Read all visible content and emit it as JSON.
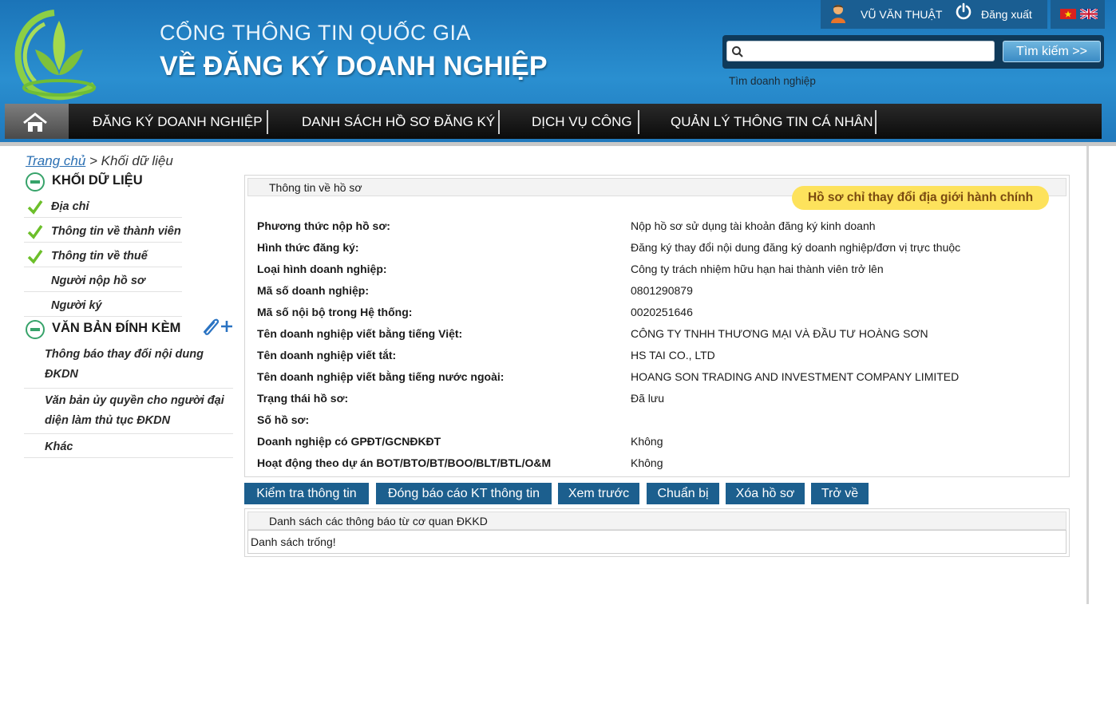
{
  "header": {
    "title_line1": "CỔNG THÔNG TIN QUỐC GIA",
    "title_line2": "VỀ ĐĂNG KÝ DOANH NGHIỆP",
    "user_name": "VŨ VĂN THUẬT",
    "logout": "Đăng xuất",
    "search_placeholder": "",
    "search_button": "Tìm kiếm >>",
    "search_link": "Tìm doanh nghiệp"
  },
  "nav": {
    "items": [
      {
        "label": "ĐĂNG KÝ DOANH NGHIỆP"
      },
      {
        "label": "DANH SÁCH HỒ SƠ ĐĂNG KÝ"
      },
      {
        "label": "DỊCH VỤ CÔNG"
      },
      {
        "label": "QUẢN LÝ THÔNG TIN CÁ NHÂN"
      }
    ]
  },
  "breadcrumb": {
    "home": "Trang chủ",
    "separator": " > ",
    "current": "Khối dữ liệu"
  },
  "sidebar": {
    "section1_title": "KHỐI DỮ LIỆU",
    "section1_items": [
      {
        "label": "Địa chỉ",
        "checked": true
      },
      {
        "label": "Thông tin về thành viên",
        "checked": true
      },
      {
        "label": "Thông tin về thuế",
        "checked": true
      },
      {
        "label": "Người nộp hồ sơ",
        "checked": false
      },
      {
        "label": "Người ký",
        "checked": false
      }
    ],
    "section2_title": "VĂN BẢN ĐÍNH KÈM",
    "section2_items": [
      {
        "line1": "Thông báo thay đổi nội dung",
        "line2": "ĐKDN"
      },
      {
        "line1": "Văn bản ủy quyền cho người đại",
        "line2": "diện làm thủ tục ĐKDN"
      },
      {
        "line1": "Khác",
        "line2": ""
      }
    ]
  },
  "record": {
    "panel_title": "Thông tin về hồ sơ",
    "badge": "Hồ sơ chỉ thay đổi địa giới hành chính",
    "rows": [
      {
        "label": "Phương thức nộp hồ sơ:",
        "value": "Nộp hồ sơ sử dụng tài khoản đăng ký kinh doanh"
      },
      {
        "label": "Hình thức đăng ký:",
        "value": "Đăng ký thay đổi nội dung đăng ký doanh nghiệp/đơn vị trực thuộc"
      },
      {
        "label": "Loại hình doanh nghiệp:",
        "value": "Công ty trách nhiệm hữu hạn hai thành viên trở lên"
      },
      {
        "label": "Mã số doanh nghiệp:",
        "value": "0801290879"
      },
      {
        "label": "Mã số nội bộ trong Hệ thống:",
        "value": "0020251646"
      },
      {
        "label": "Tên doanh nghiệp viết bằng tiếng Việt:",
        "value": "CÔNG TY TNHH THƯƠNG MẠI VÀ ĐẦU TƯ HOÀNG SƠN"
      },
      {
        "label": "Tên doanh nghiệp viết tắt:",
        "value": "HS TAI CO., LTD"
      },
      {
        "label": "Tên doanh nghiệp viết bằng tiếng nước ngoài:",
        "value": "HOANG SON TRADING AND INVESTMENT COMPANY LIMITED"
      },
      {
        "label": "Trạng thái hồ sơ:",
        "value": "Đã lưu"
      },
      {
        "label": "Số hồ sơ:",
        "value": ""
      },
      {
        "label": "Doanh nghiệp có GPĐT/GCNĐKĐT",
        "value": "Không"
      },
      {
        "label": "Hoạt động theo dự án BOT/BTO/BT/BOO/BLT/BTL/O&M",
        "value": "Không"
      }
    ]
  },
  "actions": {
    "check": "Kiểm tra thông tin",
    "report": "Đóng báo cáo KT thông tin",
    "preview": "Xem trước",
    "prepare": "Chuẩn bị",
    "delete": "Xóa hồ sơ",
    "back": "Trở về"
  },
  "notices": {
    "title": "Danh sách các thông báo từ cơ quan ĐKKD",
    "empty": "Danh sách trống!"
  },
  "colors": {
    "header_blue": "#2a8fd0",
    "nav_dark": "#111111",
    "button_blue": "#1c5f8e",
    "badge_yellow": "#fde25c",
    "check_green": "#6cbf2a"
  }
}
